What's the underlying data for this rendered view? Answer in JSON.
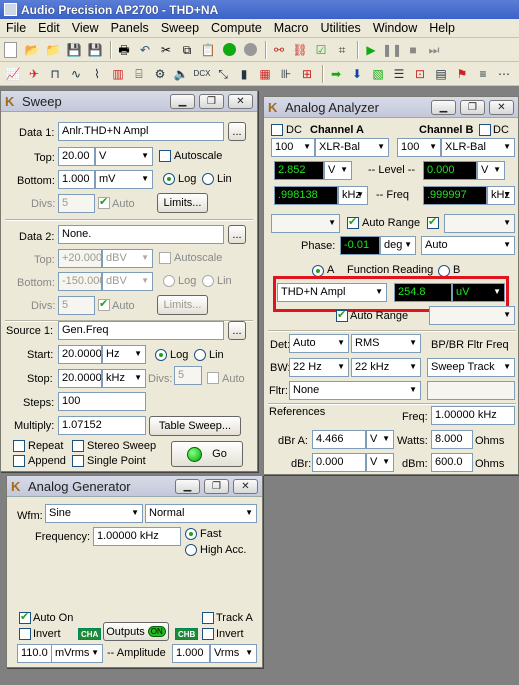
{
  "app": {
    "title": "Audio Precision AP2700 - THD+NA"
  },
  "menu": [
    "File",
    "Edit",
    "View",
    "Panels",
    "Sweep",
    "Compute",
    "Macro",
    "Utilities",
    "Window",
    "Help"
  ],
  "sweep": {
    "title": "Sweep",
    "data1": {
      "label": "Data 1:",
      "value": "Anlr.THD+N Ampl",
      "top_label": "Top:",
      "top_value": "20.00",
      "top_unit": "V",
      "autoscale": "Autoscale",
      "bottom_label": "Bottom:",
      "bottom_value": "1.000",
      "bottom_unit": "mV",
      "log": "Log",
      "lin": "Lin",
      "divs_label": "Divs:",
      "divs_value": "5",
      "auto": "Auto",
      "limits": "Limits..."
    },
    "data2": {
      "label": "Data 2:",
      "value": "None.",
      "top_label": "Top:",
      "top_value": "+20.000",
      "top_unit": "dBV",
      "autoscale": "Autoscale",
      "bottom_label": "Bottom:",
      "bottom_value": "-150.000",
      "bottom_unit": "dBV",
      "log": "Log",
      "lin": "Lin",
      "divs_label": "Divs:",
      "divs_value": "5",
      "auto": "Auto",
      "limits": "Limits..."
    },
    "source1": {
      "label": "Source 1:",
      "value": "Gen.Freq",
      "start_label": "Start:",
      "start_value": "20.0000",
      "start_unit": "Hz",
      "log": "Log",
      "lin": "Lin",
      "stop_label": "Stop:",
      "stop_value": "20.0000",
      "stop_unit": "kHz",
      "divs_label": "Divs:",
      "divs_value": "5",
      "auto": "Auto",
      "steps_label": "Steps:",
      "steps_value": "100",
      "multiply_label": "Multiply:",
      "multiply_value": "1.07152",
      "table_sweep": "Table Sweep..."
    },
    "repeat": "Repeat",
    "stereo": "Stereo Sweep",
    "append": "Append",
    "single": "Single Point",
    "go": "Go"
  },
  "analyzer": {
    "title": "Analog Analyzer",
    "dc": "DC",
    "channel_a": "Channel A",
    "channel_b": "Channel B",
    "a_range": "100",
    "a_input": "XLR-Bal",
    "b_range": "100",
    "b_input": "XLR-Bal",
    "level_a_val": "2.852",
    "level_a_unit": "V",
    "level_label": "-- Level --",
    "level_b_val": "0.000",
    "level_b_unit": "V",
    "freq_a_val": ".998138",
    "freq_a_unit": "kHz",
    "freq_label": "-- Freq",
    "freq_b_val": ".999997",
    "freq_b_unit": "kHz",
    "auto_range": "Auto Range",
    "phase_label": "Phase:",
    "phase_val": "-0.01",
    "phase_unit": "deg",
    "phase_mode": "Auto",
    "a_label": "A",
    "function_reading": "Function Reading",
    "b_label": "B",
    "func_select": "THD+N Ampl",
    "func_val": "254.8",
    "func_unit": "uV",
    "auto_range2": "Auto Range",
    "det_label": "Det:",
    "det_val": "Auto",
    "rms": "RMS",
    "bpbr": "BP/BR Fltr Freq",
    "bw_label": "BW:",
    "bw_low": "22 Hz",
    "bw_high": "22 kHz",
    "sweep_track": "Sweep Track",
    "fltr_label": "Fltr:",
    "fltr_val": "None",
    "refs_label": "References",
    "freq_ref_label": "Freq:",
    "freq_ref_val": "1.00000 kHz",
    "dbra_label": "dBr A:",
    "dbra_val": "4.466",
    "dbra_unit": "V",
    "watts_label": "Watts:",
    "watts_val": "8.000",
    "watts_unit": "Ohms",
    "dbr_label": "dBr:",
    "dbr_val": "0.000",
    "dbr_unit": "V",
    "dbm_label": "dBm:",
    "dbm_val": "600.0",
    "dbm_unit": "Ohms"
  },
  "generator": {
    "title": "Analog Generator",
    "wfm_label": "Wfm:",
    "wfm_val": "Sine",
    "wfm_mode": "Normal",
    "freq_label": "Frequency:",
    "freq_val": "1.00000 kHz",
    "fast": "Fast",
    "high_acc": "High Acc.",
    "auto_on": "Auto On",
    "track_a": "Track A",
    "invert_a": "Invert",
    "cha": "CHA",
    "outputs": "Outputs",
    "on": "ON",
    "chb": "CHB",
    "invert_b": "Invert",
    "amp_a_val": "110.0",
    "amp_a_unit": "mVrms",
    "amp_label": "-- Amplitude",
    "amp_b_val": "1.000",
    "amp_b_unit": "Vrms"
  }
}
